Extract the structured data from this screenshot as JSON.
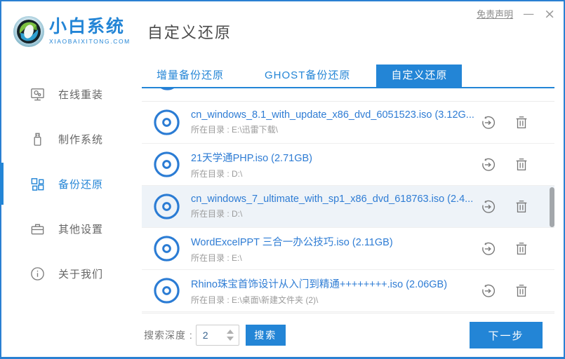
{
  "colors": {
    "accent": "#2385d6",
    "row_highlight": "#eef3f8"
  },
  "header": {
    "logo_name": "小白系统",
    "logo_domain": "XIAOBAIXITONG.COM",
    "logo_icon": "sphere-swirl-logo",
    "page_title": "自定义还原",
    "disclaimer_link": "免责声明",
    "minimize_label": "—",
    "close_label": "×"
  },
  "sidebar": {
    "items": [
      {
        "label": "在线重装",
        "icon": "monitor-icon",
        "active": false
      },
      {
        "label": "制作系统",
        "icon": "usb-drive-icon",
        "active": false
      },
      {
        "label": "备份还原",
        "icon": "blocks-icon",
        "active": true
      },
      {
        "label": "其他设置",
        "icon": "toolbox-icon",
        "active": false
      },
      {
        "label": "关于我们",
        "icon": "info-icon",
        "active": false
      }
    ]
  },
  "tabs": [
    {
      "label": "增量备份还原",
      "active": false
    },
    {
      "label": "GHOST备份还原",
      "active": false
    },
    {
      "label": "自定义还原",
      "active": true
    }
  ],
  "list": {
    "row_icon": "disc-icon",
    "action_icons": [
      "restore-icon",
      "trash-icon"
    ],
    "rows": [
      {
        "title": "cn_windows_8.1_with_update_x86_dvd_6051523.iso (3.12G...",
        "path": "所在目录 : E:\\迅雷下载\\",
        "highlighted": false
      },
      {
        "title": "21天学通PHP.iso (2.71GB)",
        "path": "所在目录 : D:\\",
        "highlighted": false
      },
      {
        "title": "cn_windows_7_ultimate_with_sp1_x86_dvd_618763.iso (2.4...",
        "path": "所在目录 : D:\\",
        "highlighted": true
      },
      {
        "title": "WordExcelPPT 三合一办公技巧.iso (2.11GB)",
        "path": "所在目录 : E:\\",
        "highlighted": false
      },
      {
        "title": "Rhino珠宝首饰设计从入门到精通++++++++.iso (2.06GB)",
        "path": "所在目录 : E:\\桌面\\新建文件夹 (2)\\",
        "highlighted": false
      }
    ]
  },
  "footer": {
    "depth_label": "搜索深度 :",
    "depth_value": "2",
    "search_button": "搜索",
    "next_button": "下一步"
  }
}
